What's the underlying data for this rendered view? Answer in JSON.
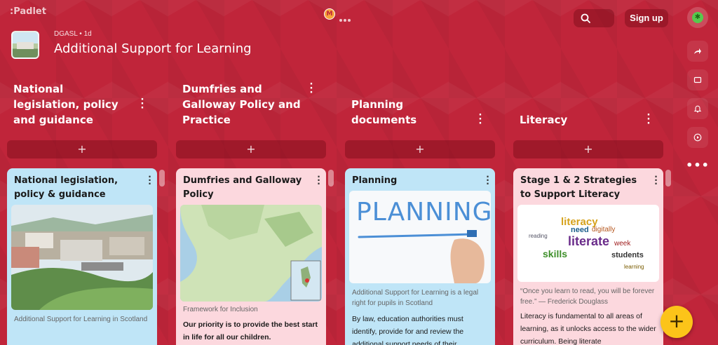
{
  "app": {
    "logo": ":Padlet",
    "badge_letter": "M"
  },
  "topbar": {
    "signup_label": "Sign up"
  },
  "board": {
    "author": "DGASL",
    "time": "1d",
    "title": "Additional Support for Learning"
  },
  "columns": [
    {
      "title": "National legislation, policy and guidance",
      "add": "+"
    },
    {
      "title": "Dumfries and Galloway Policy and Practice",
      "add": "+"
    },
    {
      "title": "Planning documents",
      "add": "+"
    },
    {
      "title": "Literacy",
      "add": "+"
    }
  ],
  "cards": [
    {
      "title": "National legislation, policy & guidance",
      "subtitle": "Additional Support for Learning in Scotland",
      "color": "#bfe5f7"
    },
    {
      "title": "Dumfries and Galloway Policy",
      "subtitle": "Framework for Inclusion",
      "body": "Our priority is to provide the best start in life for all our children.",
      "color": "#fcd8de"
    },
    {
      "title": "Planning",
      "image_text": "PLANNING",
      "subtitle": "Additional Support for Learning is a legal right for pupils in Scotland",
      "body": "By law, education authorities must identify, provide for and review the additional support needs of their",
      "color": "#bfe5f7"
    },
    {
      "title": "Stage 1 & 2 Strategies to Support Literacy",
      "word_cloud": [
        "literacy",
        "literate",
        "skills",
        "students",
        "need",
        "digitally",
        "week",
        "reading",
        "learning"
      ],
      "subtitle": "“Once you learn to read, you will be forever free.” — Frederick Douglass",
      "body": "Literacy is fundamental to all areas of learning, as it unlocks access to the wider curriculum. Being literate",
      "color": "#fcd8de"
    }
  ],
  "fab": {
    "label": "+"
  },
  "colors": {
    "background": "#c0253a",
    "card_blue": "#bfe5f7",
    "card_pink": "#fcd8de",
    "fab": "#fcc419"
  }
}
